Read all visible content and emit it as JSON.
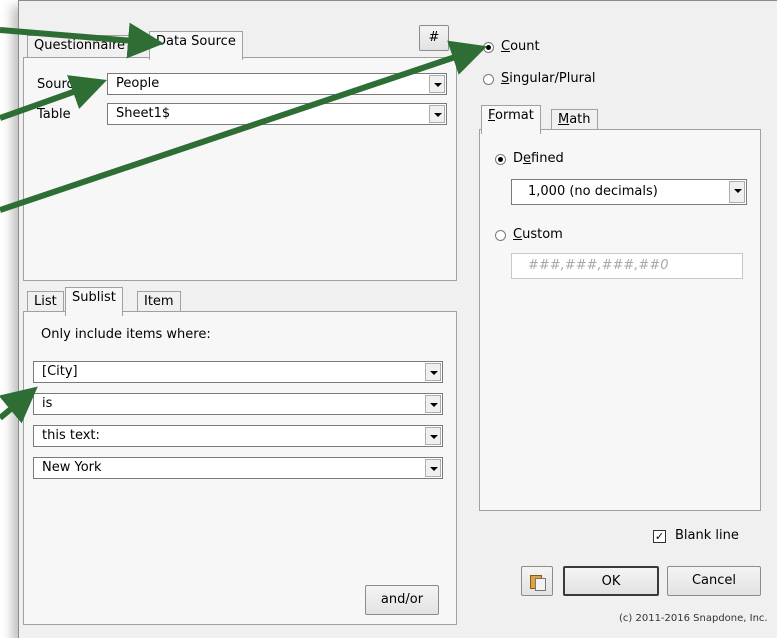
{
  "top_tabs": {
    "questionnaire": "Questionnaire",
    "data_source": "Data Source"
  },
  "hash_button": "#",
  "source": {
    "label": "Source",
    "value": "People"
  },
  "table": {
    "label": "Table",
    "value": "Sheet1$"
  },
  "mode": {
    "count": {
      "prefix": "",
      "accel": "C",
      "rest": "ount",
      "selected": true
    },
    "singular": {
      "prefix": "",
      "accel": "S",
      "rest": "ingular/Plural",
      "selected": false
    }
  },
  "right_tabs": {
    "format": {
      "accel": "F",
      "rest": "ormat"
    },
    "math": {
      "accel": "M",
      "rest": "ath"
    }
  },
  "format": {
    "defined": {
      "prefix": "D",
      "accel": "e",
      "rest": "fined",
      "selected": true
    },
    "defined_value": "1,000 (no decimals)",
    "custom": {
      "accel": "C",
      "rest": "ustom",
      "selected": false
    },
    "custom_placeholder": "###,###,###,##0"
  },
  "lower_tabs": {
    "list": "List",
    "sublist": "Sublist",
    "item": "Item"
  },
  "sublist": {
    "heading": "Only include items where:",
    "field": "[City]",
    "operator": "is",
    "comparison": "this text:",
    "value": "New York"
  },
  "and_or_button": "and/or",
  "blank_line": {
    "label": "Blank line",
    "checked": true
  },
  "buttons": {
    "ok": "OK",
    "cancel": "Cancel"
  },
  "copyright": "(c) 2011-2016 Snapdone, Inc.",
  "colors": {
    "annotation_arrow": "#2e6e35",
    "dialog_bg": "#f0f0f0"
  }
}
